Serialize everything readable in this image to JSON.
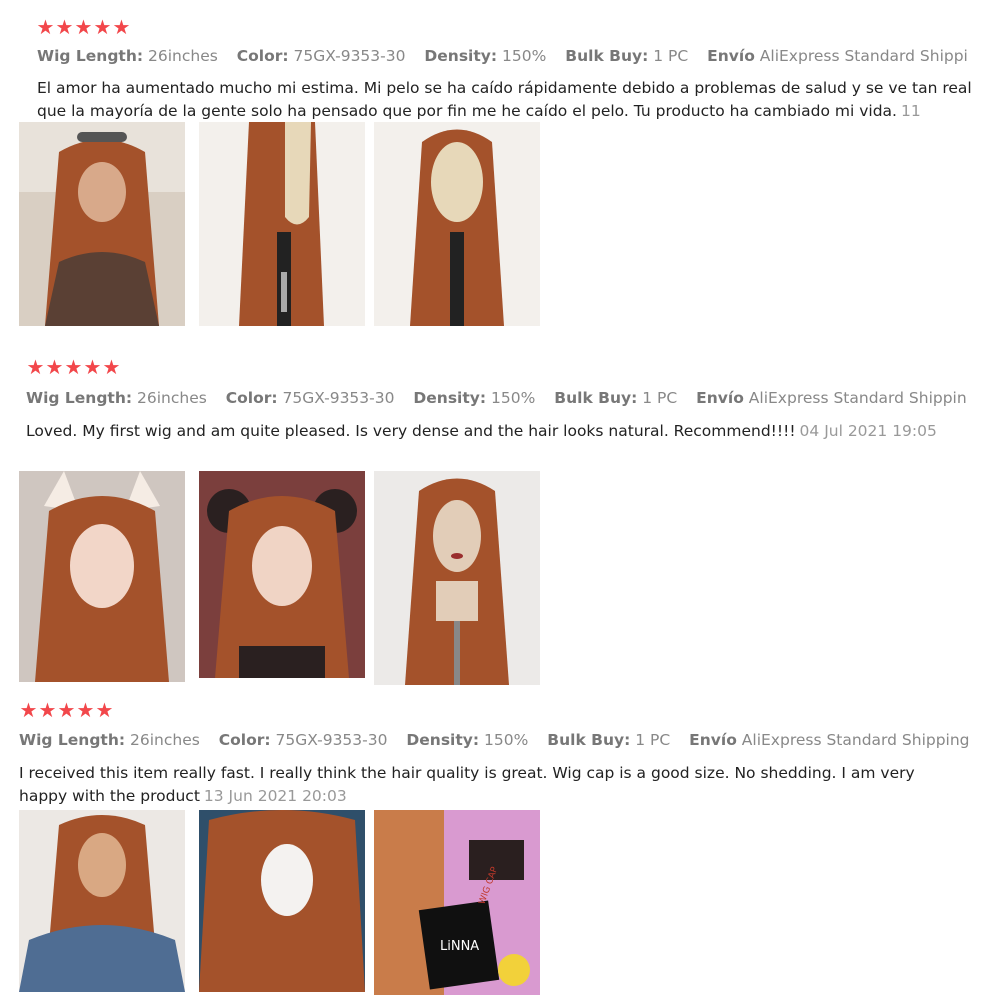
{
  "rating_stars": 5,
  "colors": {
    "star": "#f2474b",
    "hair": "#a4522b",
    "meta_label": "#777777",
    "meta_value": "#888888",
    "text": "#222222",
    "date": "#999999"
  },
  "reviews": [
    {
      "attributes": [
        {
          "label": "Wig Length:",
          "value": "26inches"
        },
        {
          "label": "Color:",
          "value": "75GX-9353-30"
        },
        {
          "label": "Density:",
          "value": "150%"
        },
        {
          "label": "Bulk Buy:",
          "value": "1 PC"
        },
        {
          "label": "Envío",
          "value": "AliExpress Standard Shipping"
        }
      ],
      "text": "El amor ha aumentado mucho mi estima. Mi pelo se ha caído rápidamente debido a problemas de salud y se ve tan real que la mayoría de la gente solo ha pensado que por fin me he caído el pelo. Tu producto ha cambiado mi vida.",
      "date": "11",
      "photos": [
        "photo-woman-sunglasses",
        "photo-mannequin-lace-front",
        "photo-mannequin-front"
      ]
    },
    {
      "attributes": [
        {
          "label": "Wig Length:",
          "value": "26inches"
        },
        {
          "label": "Color:",
          "value": "75GX-9353-30"
        },
        {
          "label": "Density:",
          "value": "150%"
        },
        {
          "label": "Bulk Buy:",
          "value": "1 PC"
        },
        {
          "label": "Envío",
          "value": "AliExpress Standard Shippin"
        }
      ],
      "text": "Loved. My first wig and am quite pleased. Is very dense and the hair looks natural. Recommend!!!!",
      "date": "04 Jul 2021 19:05",
      "photos": [
        "photo-cosplay-cat-ears",
        "photo-cosplay-horns",
        "photo-mannequin-red-lips"
      ]
    },
    {
      "attributes": [
        {
          "label": "Wig Length:",
          "value": "26inches"
        },
        {
          "label": "Color:",
          "value": "75GX-9353-30"
        },
        {
          "label": "Density:",
          "value": "150%"
        },
        {
          "label": "Bulk Buy:",
          "value": "1 PC"
        },
        {
          "label": "Envío",
          "value": "AliExpress Standard Shipping"
        }
      ],
      "text": "I received this item really fast. I really think the hair quality is great. Wig cap is a good size. No shedding. I am very happy with the product",
      "date": "13 Jun 2021 20:03",
      "photos": [
        "photo-woman-denim-jacket",
        "photo-wig-cap-inside",
        "photo-wig-with-linna-packaging"
      ]
    }
  ],
  "packaging_brand": "LiNNA",
  "packaging_label": "WIG CAP"
}
